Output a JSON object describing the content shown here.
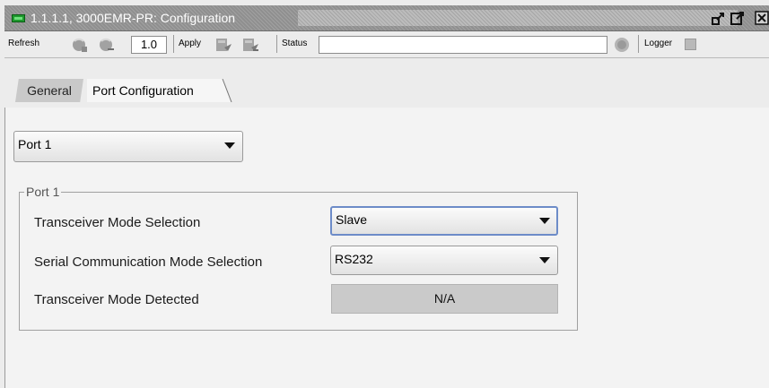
{
  "window": {
    "title": "1.1.1.1, 3000EMR-PR: Configuration",
    "icon": "module-card-icon",
    "controls": [
      "restore-icon",
      "maximize-icon",
      "close-icon"
    ]
  },
  "toolbar": {
    "refresh_label": "Refresh",
    "version_value": "1.0",
    "apply_label": "Apply",
    "status_label": "Status",
    "status_value": "",
    "logger_label": "Logger"
  },
  "tabs": [
    {
      "label": "General",
      "active": false
    },
    {
      "label": "Port Configuration",
      "active": true
    }
  ],
  "port_selector": {
    "selected": "Port 1"
  },
  "port_group": {
    "legend": "Port 1",
    "rows": [
      {
        "label": "Transceiver Mode Selection",
        "value": "Slave",
        "kind": "select"
      },
      {
        "label": "Serial Communication Mode Selection",
        "value": "RS232",
        "kind": "select"
      },
      {
        "label": "Transceiver Mode Detected",
        "value": "N/A",
        "kind": "readonly"
      }
    ]
  },
  "colors": {
    "titlebar": "#8f8f8f",
    "background": "#ececec",
    "content": "#f3f3f3",
    "focus_border": "#6d8cc8",
    "readonly_field": "#cacaca"
  }
}
